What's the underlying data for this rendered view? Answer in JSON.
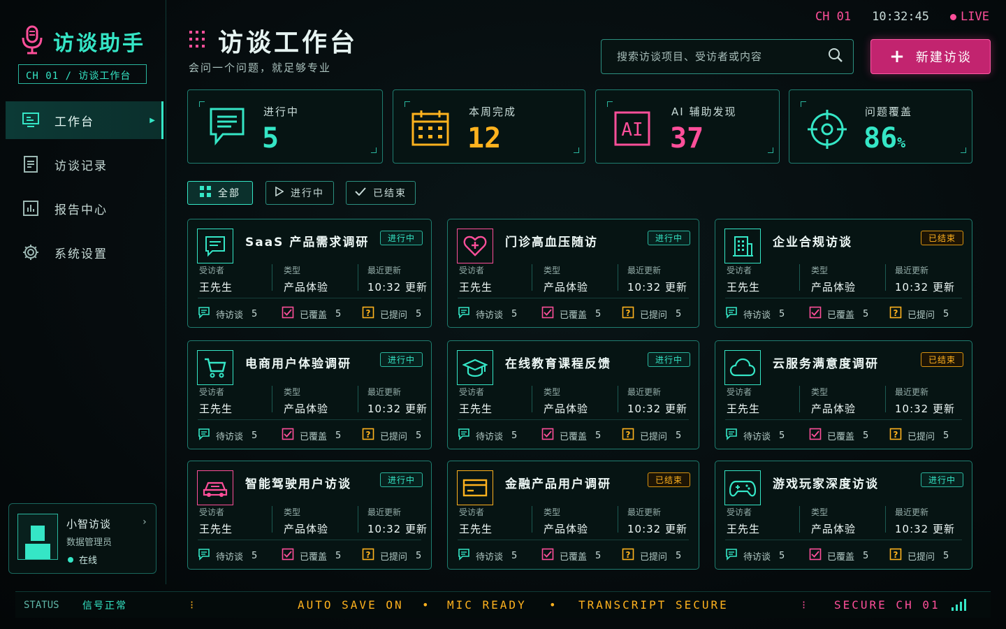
{
  "app": {
    "title": "访谈助手",
    "channel_crumb": "CH 01 / 访谈工作台"
  },
  "nav": {
    "items": [
      {
        "label": "工作台",
        "active": true
      },
      {
        "label": "访谈记录",
        "active": false
      },
      {
        "label": "报告中心",
        "active": false
      },
      {
        "label": "系统设置",
        "active": false
      }
    ]
  },
  "user": {
    "name": "小智访谈",
    "role": "数据管理员",
    "status": "在线"
  },
  "header": {
    "title": "访谈工作台",
    "subtitle": "会问一个问题，就足够专业",
    "channel": "CH 01",
    "time": "10:32:45",
    "live": "LIVE",
    "search_placeholder": "搜索访谈项目、受访者或内容",
    "new_button": "新建访谈"
  },
  "stats": [
    {
      "label": "进行中",
      "value": "5",
      "unit": "",
      "icon": "chat-icon",
      "color": "#35e6c6"
    },
    {
      "label": "本周完成",
      "value": "12",
      "unit": "",
      "icon": "calendar-icon",
      "color": "#ffb21e"
    },
    {
      "label": "AI 辅助发现",
      "value": "37",
      "unit": "",
      "icon": "ai-icon",
      "color": "#ff4f9a"
    },
    {
      "label": "问题覆盖",
      "value": "86",
      "unit": "%",
      "icon": "target-icon",
      "color": "#35e6c6"
    }
  ],
  "filters": [
    {
      "label": "全部",
      "active": true
    },
    {
      "label": "进行中",
      "active": false
    },
    {
      "label": "已结束",
      "active": false
    }
  ],
  "meta_labels": {
    "interviewee": "受访者",
    "type": "类型",
    "updated": "最近更新"
  },
  "foot_labels": {
    "pending": "待访谈",
    "covered": "已覆盖",
    "asked": "已提问"
  },
  "projects": [
    {
      "title": "SaaS 产品需求调研",
      "status": "进行中",
      "state": "on",
      "icon": "chat-icon",
      "icon_color": "#35e6c6",
      "interviewee": "王先生",
      "type": "产品体验",
      "updated": "10:32 更新",
      "pending": "5",
      "covered": "5",
      "asked": "5"
    },
    {
      "title": "门诊高血压随访",
      "status": "进行中",
      "state": "on",
      "icon": "heart-icon",
      "icon_color": "#ff4f9a",
      "interviewee": "王先生",
      "type": "产品体验",
      "updated": "10:32 更新",
      "pending": "5",
      "covered": "5",
      "asked": "5"
    },
    {
      "title": "企业合规访谈",
      "status": "已结束",
      "state": "off",
      "icon": "building-icon",
      "icon_color": "#35e6c6",
      "interviewee": "王先生",
      "type": "产品体验",
      "updated": "10:32 更新",
      "pending": "5",
      "covered": "5",
      "asked": "5"
    },
    {
      "title": "电商用户体验调研",
      "status": "进行中",
      "state": "on",
      "icon": "cart-icon",
      "icon_color": "#35e6c6",
      "interviewee": "王先生",
      "type": "产品体验",
      "updated": "10:32 更新",
      "pending": "5",
      "covered": "5",
      "asked": "5"
    },
    {
      "title": "在线教育课程反馈",
      "status": "进行中",
      "state": "on",
      "icon": "graduation-cap-icon",
      "icon_color": "#35e6c6",
      "interviewee": "王先生",
      "type": "产品体验",
      "updated": "10:32 更新",
      "pending": "5",
      "covered": "5",
      "asked": "5"
    },
    {
      "title": "云服务满意度调研",
      "status": "已结束",
      "state": "off",
      "icon": "cloud-icon",
      "icon_color": "#35e6c6",
      "interviewee": "王先生",
      "type": "产品体验",
      "updated": "10:32 更新",
      "pending": "5",
      "covered": "5",
      "asked": "5"
    },
    {
      "title": "智能驾驶用户访谈",
      "status": "进行中",
      "state": "on",
      "icon": "car-icon",
      "icon_color": "#ff4f9a",
      "interviewee": "王先生",
      "type": "产品体验",
      "updated": "10:32 更新",
      "pending": "5",
      "covered": "5",
      "asked": "5"
    },
    {
      "title": "金融产品用户调研",
      "status": "已结束",
      "state": "off",
      "icon": "card-icon",
      "icon_color": "#ffb21e",
      "interviewee": "王先生",
      "type": "产品体验",
      "updated": "10:32 更新",
      "pending": "5",
      "covered": "5",
      "asked": "5"
    },
    {
      "title": "游戏玩家深度访谈",
      "status": "进行中",
      "state": "on",
      "icon": "gamepad-icon",
      "icon_color": "#35e6c6",
      "interviewee": "王先生",
      "type": "产品体验",
      "updated": "10:32 更新",
      "pending": "5",
      "covered": "5",
      "asked": "5"
    }
  ],
  "statusbar": {
    "label": "STATUS",
    "signal": "信号正常",
    "items": [
      "AUTO SAVE ON",
      "MIC READY",
      "TRANSCRIPT SECURE"
    ],
    "secure": "SECURE CH 01"
  }
}
